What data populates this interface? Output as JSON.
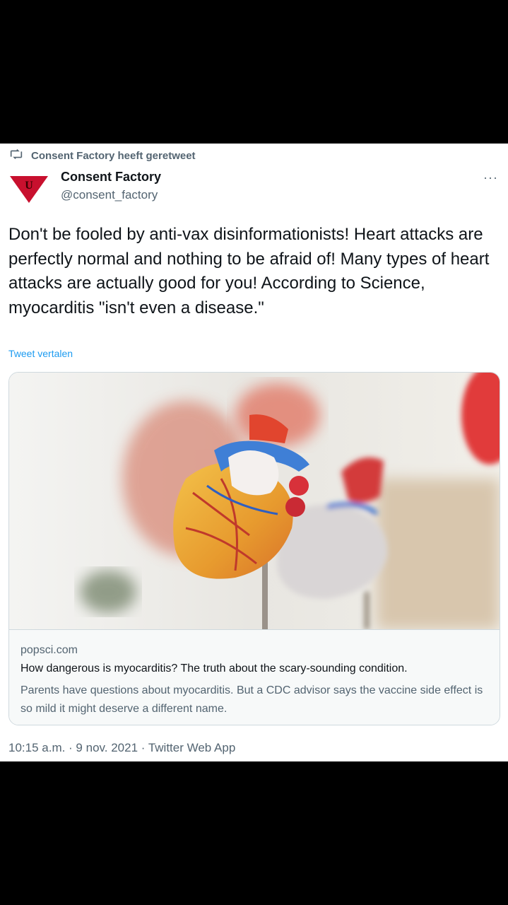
{
  "retweet": {
    "label": "Consent Factory heeft geretweet",
    "icon": "retweet-icon"
  },
  "author": {
    "name": "Consent Factory",
    "handle": "@consent_factory",
    "avatar_letter": "U",
    "avatar_color": "#c8102e"
  },
  "more_label": "···",
  "tweet_text": "Don't be fooled by anti-vax disinformationists! Heart attacks are perfectly normal and nothing to be afraid of! Many types of heart attacks are actually good for you! According to Science, myocarditis \"isn't even a disease.\"",
  "translate_label": "Tweet vertalen",
  "card": {
    "image_subject": "anatomical-heart-model-photo",
    "domain": "popsci.com",
    "title": "How dangerous is myocarditis? The truth about the scary-sounding condition.",
    "description": "Parents have questions about myocarditis. But a CDC advisor says the vaccine side effect is so mild it might deserve a different name."
  },
  "meta": "10:15 a.m. · 9 nov. 2021 · Twitter Web App",
  "colors": {
    "link": "#1d9bf0",
    "secondary": "#536471",
    "border": "#cfd9de"
  }
}
